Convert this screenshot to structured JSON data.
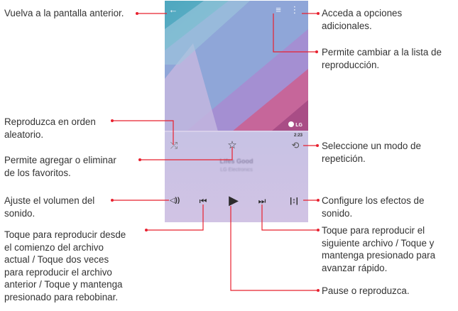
{
  "annotations": {
    "back": "Vuelva a la pantalla anterior.",
    "options_1": "Acceda a opciones",
    "options_2": "adicionales.",
    "playlist_1": "Permite cambiar a la lista de",
    "playlist_2": "reproducción.",
    "shuffle_1": "Reproduzca en orden",
    "shuffle_2": "aleatorio.",
    "favorite_1": "Permite agregar o eliminar",
    "favorite_2": "de los favoritos.",
    "repeat_1": "Seleccione un modo de",
    "repeat_2": "repetición.",
    "volume_1": "Ajuste el volumen del",
    "volume_2": "sonido.",
    "effects_1": "Configure los efectos de",
    "effects_2": "sonido.",
    "prev_1": "Toque para reproducir desde",
    "prev_2": "el comienzo del archivo",
    "prev_3": "actual / Toque dos veces",
    "prev_4": "para reproducir el archivo",
    "prev_5": "anterior / Toque y mantenga",
    "prev_6": "presionado para rebobinar.",
    "next_1": "Toque para reproducir el",
    "next_2": "siguiente archivo / Toque y",
    "next_3": "mantenga presionado para",
    "next_4": "avanzar rápido.",
    "play": "Pause o reproduzca."
  },
  "player": {
    "back_glyph": "←",
    "playlist_glyph": "≡",
    "menu_glyph": "⋮",
    "logo_text": "LG",
    "time": "2:23",
    "song_title": "Lifes Good",
    "artist": "LG Electronics",
    "shuffle_glyph": "⤮",
    "star_glyph": "☆",
    "repeat_glyph": "⟲",
    "volume_glyph": "◁))",
    "prev_glyph": "⏮",
    "play_glyph": "▶",
    "next_glyph": "⏭",
    "effects_glyph": "|↕|"
  },
  "colors": {
    "accent_lines": "#e8212f",
    "icon_dark": "#2c2c2c",
    "topbar": "#5ba4bd"
  }
}
